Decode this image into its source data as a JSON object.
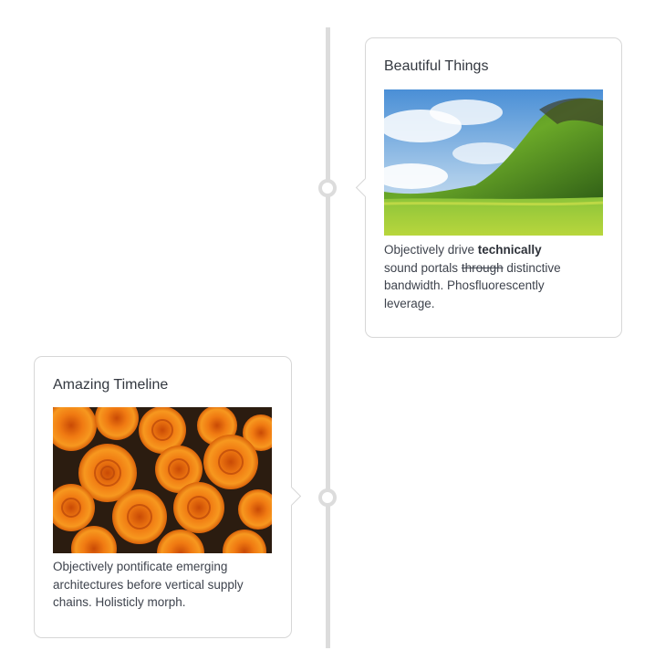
{
  "timeline": {
    "items": [
      {
        "title": "Beautiful Things",
        "image_alt": "green-hill-landscape",
        "text_part1": "Objectively drive ",
        "text_bold": "technically",
        "text_part2": " sound portals ",
        "text_strike": "through",
        "text_part3": " distinctive bandwidth. Phosfluorescently leverage."
      },
      {
        "title": "Amazing Timeline",
        "image_alt": "orange-roses",
        "text": "Objectively pontificate emerging architectures before vertical supply chains. Holisticly morph."
      }
    ]
  },
  "colors": {
    "line": "#dcdcdc",
    "border": "#d7d7d7",
    "text": "#3e434d"
  }
}
